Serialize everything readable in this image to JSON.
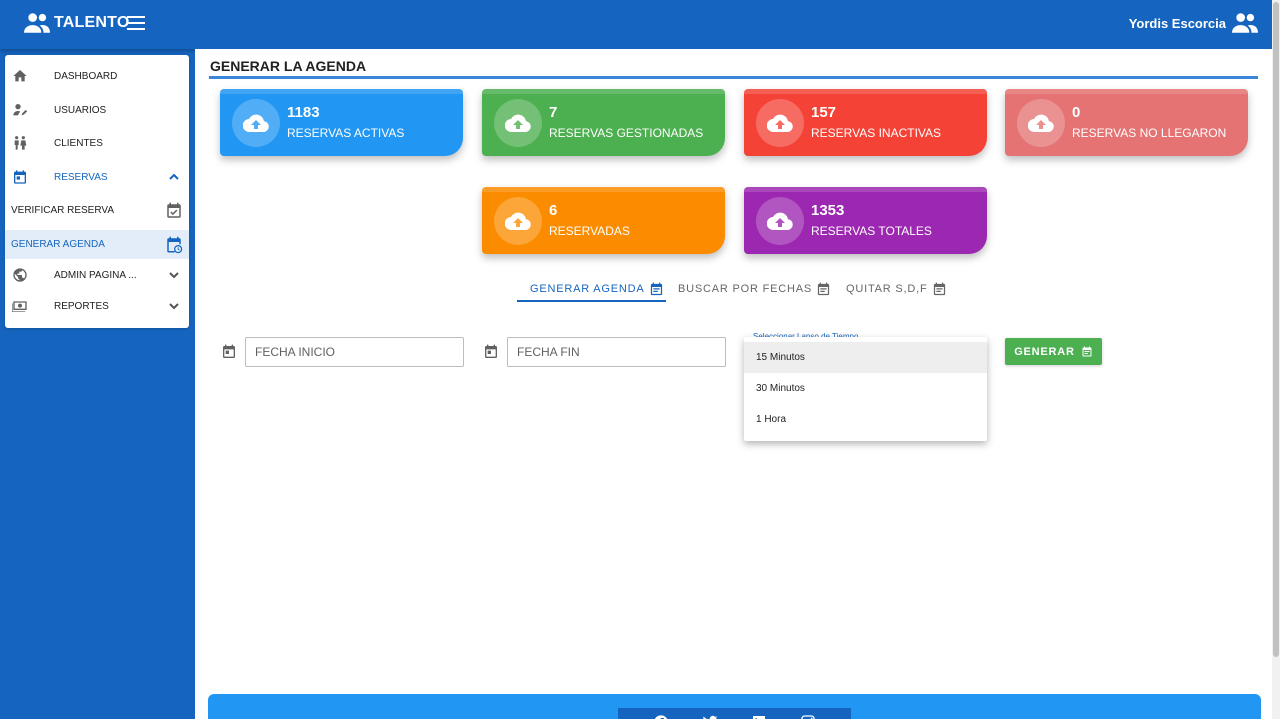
{
  "header": {
    "app_title": "TALENTO",
    "user_name": "Yordis Escorcia"
  },
  "sidebar": {
    "items": [
      {
        "label": "DASHBOARD",
        "icon": "home-icon"
      },
      {
        "label": "USUARIOS",
        "icon": "user-edit-icon"
      },
      {
        "label": "CLIENTES",
        "icon": "people-icon"
      },
      {
        "label": "RESERVAS",
        "icon": "calendar-icon",
        "expanded": true
      },
      {
        "label": "ADMIN PAGINA ...",
        "icon": "globe-icon",
        "expanded": false
      },
      {
        "label": "REPORTES",
        "icon": "money-icon",
        "expanded": false
      }
    ],
    "subitems": [
      {
        "label": "VERIFICAR RESERVA",
        "icon": "calendar-check-icon"
      },
      {
        "label": "GENERAR AGENDA",
        "icon": "calendar-clock-icon",
        "selected": true
      }
    ]
  },
  "main": {
    "title": "GENERAR LA AGENDA",
    "cards": [
      {
        "value": "1183",
        "label": "RESERVAS ACTIVAS",
        "color": "#2196f3"
      },
      {
        "value": "7",
        "label": "RESERVAS GESTIONADAS",
        "color": "#4caf50"
      },
      {
        "value": "157",
        "label": "RESERVAS INACTIVAS",
        "color": "#f44336"
      },
      {
        "value": "0",
        "label": "RESERVAS NO LLEGARON",
        "color": "#e57373"
      },
      {
        "value": "6",
        "label": "RESERVADAS",
        "color": "#fb8c00"
      },
      {
        "value": "1353",
        "label": "RESERVAS TOTALES",
        "color": "#9c27b0"
      }
    ],
    "tabs": [
      {
        "label": "GENERAR AGENDA",
        "active": true
      },
      {
        "label": "BUSCAR POR FECHAS",
        "active": false
      },
      {
        "label": "QUITAR S,D,F",
        "active": false
      }
    ],
    "form": {
      "start_placeholder": "FECHA INICIO",
      "end_placeholder": "FECHA FIN",
      "select_label": "Seleccionar Lapso de Tiempo",
      "options": [
        "15 Minutos",
        "30 Minutos",
        "1 Hora"
      ],
      "highlighted_option": "15 Minutos",
      "button_label": "GENERAR"
    }
  },
  "footer": {
    "social_icons": [
      "facebook-icon",
      "twitter-icon",
      "linkedin-icon",
      "instagram-icon"
    ]
  },
  "colors": {
    "primary": "#1565c0",
    "accent": "#2196f3",
    "success": "#4caf50"
  }
}
